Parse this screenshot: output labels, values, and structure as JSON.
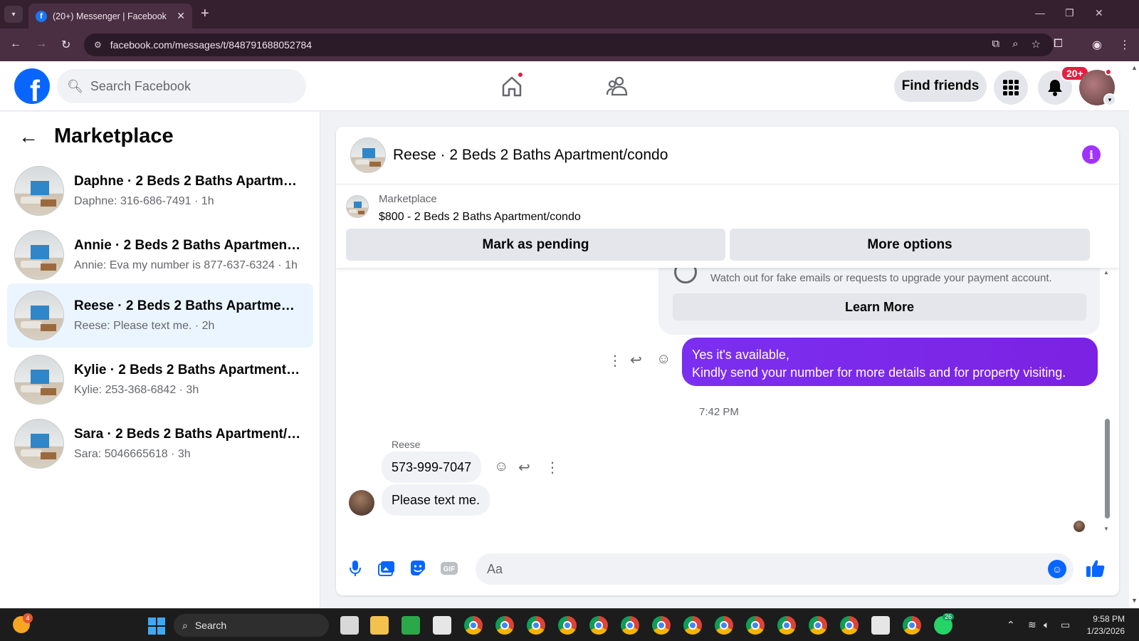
{
  "browser": {
    "tab_title": "(20+) Messenger | Facebook",
    "url": "facebook.com/messages/t/848791688052784"
  },
  "header": {
    "search_placeholder": "Search Facebook",
    "find_friends": "Find friends",
    "notif_badge": "20+"
  },
  "sidebar": {
    "title": "Marketplace",
    "conversations": [
      {
        "name": "Daphne · 2 Beds 2 Baths Apartme...",
        "preview": "Daphne: 316-686-7491 · 1h",
        "active": false
      },
      {
        "name": "Annie · 2 Beds 2 Baths Apartment/...",
        "preview": "Annie: Eva my number is 877-637-6324 · 1h",
        "active": false
      },
      {
        "name": "Reese · 2 Beds 2 Baths Apartment/...",
        "preview": "Reese: Please text me. · 2h",
        "active": true
      },
      {
        "name": "Kylie · 2 Beds 2 Baths Apartment/c...",
        "preview": "Kylie: 253-368-6842 · 3h",
        "active": false
      },
      {
        "name": "Sara · 2 Beds 2 Baths Apartment/c...",
        "preview": "Sara: 5046665618 · 3h",
        "active": false
      }
    ]
  },
  "chat": {
    "title": "Reese · 2 Beds 2 Baths Apartment/condo",
    "listing_label": "Marketplace",
    "listing_price": "$800 - 2 Beds 2 Baths Apartment/condo",
    "mark_pending": "Mark as pending",
    "more_options": "More options",
    "warning_text": "Watch out for fake emails or requests to upgrade your payment account.",
    "learn_more": "Learn More",
    "outgoing_line1": "Yes it's available,",
    "outgoing_line2": "Kindly send your number for more details and for property visiting.",
    "timestamp": "7:42 PM",
    "sender": "Reese",
    "incoming_1": "573-999-7047",
    "incoming_2": "Please text me.",
    "composer_placeholder": "Aa"
  },
  "taskbar": {
    "weather_badge": "4",
    "search_label": "Search",
    "whatsapp_badge": "26",
    "time": "9:58 PM",
    "date": "1/23/2026"
  }
}
